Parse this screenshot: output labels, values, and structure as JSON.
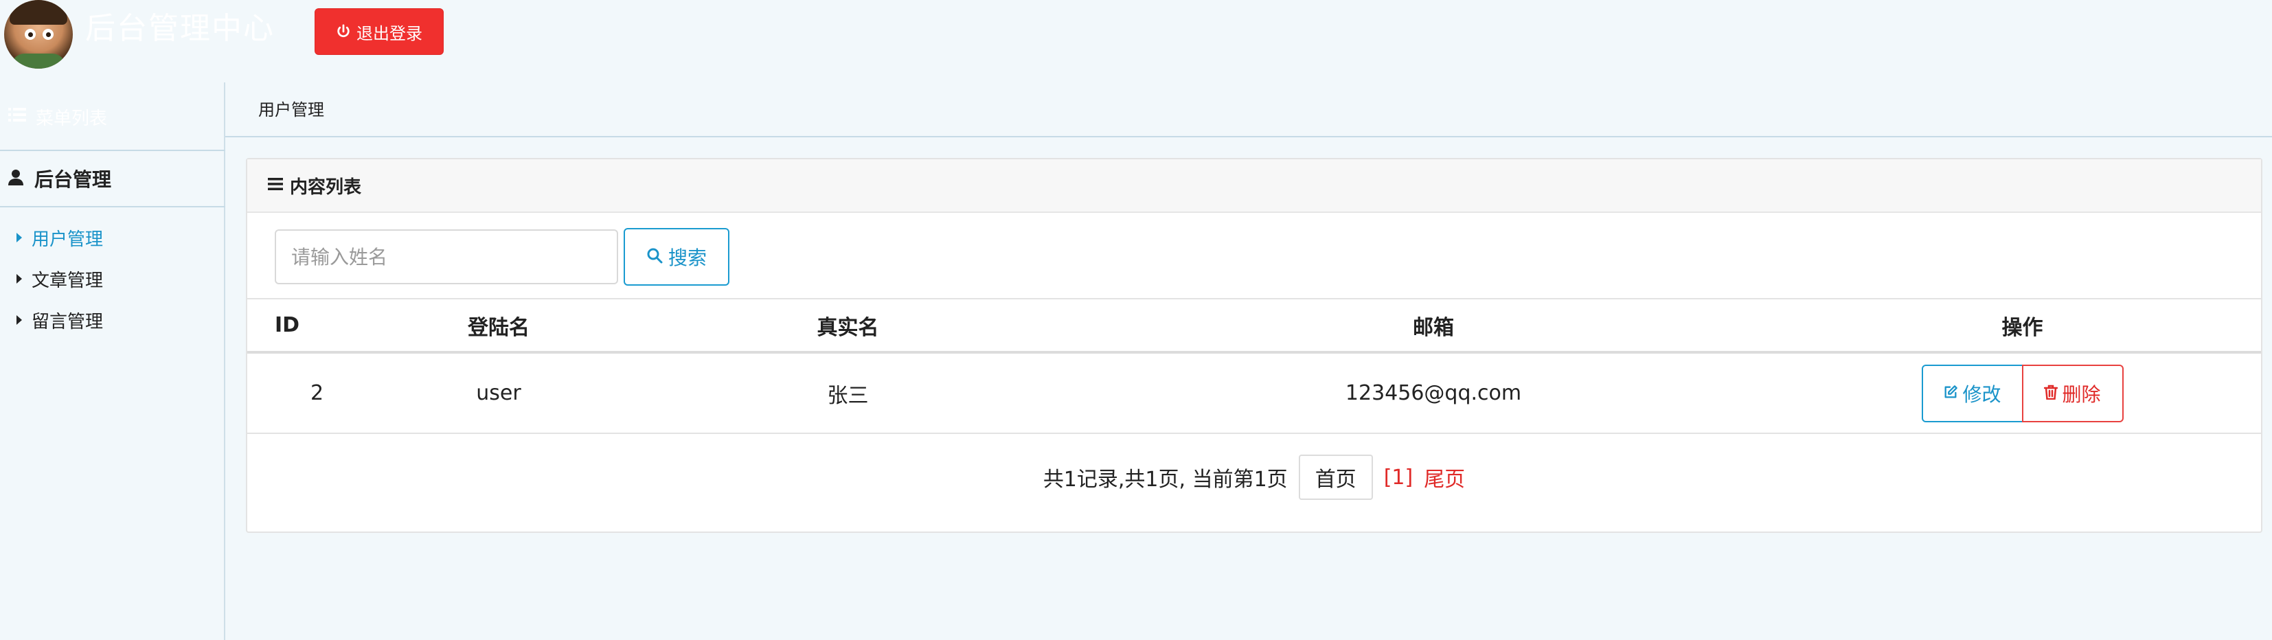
{
  "header": {
    "title": "后台管理中心",
    "logout_label": "退出登录"
  },
  "sidebar": {
    "header_label": "菜单列表",
    "group_label": "后台管理",
    "items": [
      {
        "label": "用户管理",
        "active": true
      },
      {
        "label": "文章管理",
        "active": false
      },
      {
        "label": "留言管理",
        "active": false
      }
    ]
  },
  "breadcrumb": "用户管理",
  "panel": {
    "title": "内容列表",
    "search_placeholder": "请输入姓名",
    "search_value": "",
    "search_label": "搜索"
  },
  "table": {
    "columns": [
      "ID",
      "登陆名",
      "真实名",
      "邮箱",
      "操作"
    ],
    "rows": [
      {
        "id": "2",
        "login": "user",
        "realname": "张三",
        "email": "123456@qq.com",
        "edit_label": "修改",
        "delete_label": "删除"
      }
    ]
  },
  "pagination": {
    "summary": "共1记录,共1页, 当前第1页",
    "first_label": "首页",
    "current": "[1]",
    "last_label": "尾页"
  },
  "colors": {
    "accent_blue": "#1a93c9",
    "danger_red": "#f0302e",
    "background": "#f2f8fb"
  }
}
